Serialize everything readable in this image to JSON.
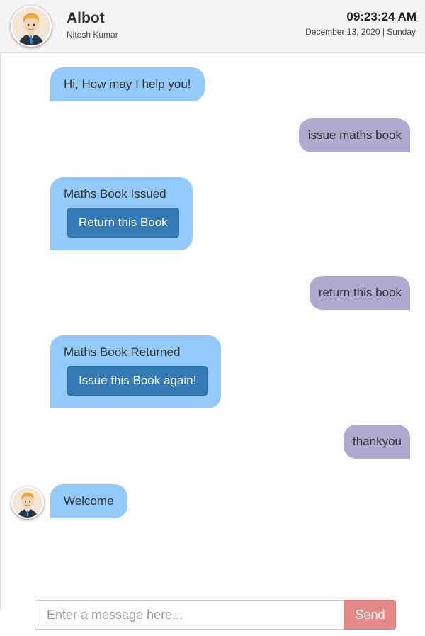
{
  "header": {
    "bot_name": "Albot",
    "user_name": "Nitesh Kumar",
    "time": "09:23:24 AM",
    "date": "December 13, 2020 | Sunday",
    "avatar_icon": "bot-avatar-icon"
  },
  "messages": [
    {
      "from": "bot",
      "text": "Hi, How may I help you!"
    },
    {
      "from": "user",
      "text": "issue maths book"
    },
    {
      "from": "bot",
      "text": "Maths Book Issued",
      "button": "Return this Book"
    },
    {
      "from": "user",
      "text": "return this book"
    },
    {
      "from": "bot",
      "text": "Maths Book Returned",
      "button": "Issue this Book again!"
    },
    {
      "from": "user",
      "text": "thankyou"
    },
    {
      "from": "bot",
      "text": "Welcome"
    }
  ],
  "composer": {
    "placeholder": "Enter a message here...",
    "value": "",
    "send_label": "Send"
  },
  "colors": {
    "bot_bubble": "#94caf9",
    "user_bubble": "#aeaacf",
    "action_button": "#337ab7",
    "send_button": "#e58a8a",
    "header_bg": "#f5f5f5"
  }
}
